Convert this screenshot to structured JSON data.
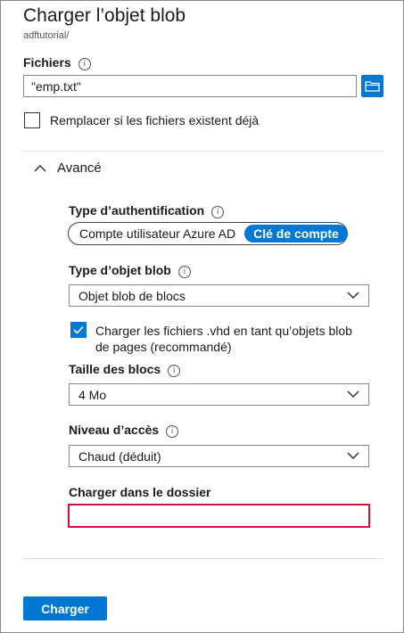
{
  "header": {
    "title": "Charger l’objet blob",
    "subtitle": "adftutorial/"
  },
  "files": {
    "label": "Fichiers",
    "value": "\"emp.txt\""
  },
  "overwrite": {
    "label": "Remplacer si les fichiers existent déjà",
    "checked": false
  },
  "advanced": {
    "toggle_label": "Avancé",
    "auth": {
      "label": "Type d’authentification",
      "options": [
        "Compte utilisateur Azure AD",
        "Clé de compte"
      ],
      "selected": "Clé de compte"
    },
    "blob_type": {
      "label": "Type d’objet blob",
      "value": "Objet blob de blocs"
    },
    "vhd": {
      "line1": "Charger les fichiers .vhd en tant qu’objets blob",
      "line2": "de pages (recommandé)",
      "checked": true
    },
    "block_size": {
      "label": "Taille des blocs",
      "value": "4 Mo"
    },
    "access_tier": {
      "label": "Niveau d’accès",
      "value": "Chaud (déduit)"
    },
    "folder": {
      "label": "Charger dans le dossier",
      "value": ""
    }
  },
  "footer": {
    "upload_label": "Charger"
  },
  "colors": {
    "accent": "#0078d4",
    "error": "#d50f3a"
  }
}
